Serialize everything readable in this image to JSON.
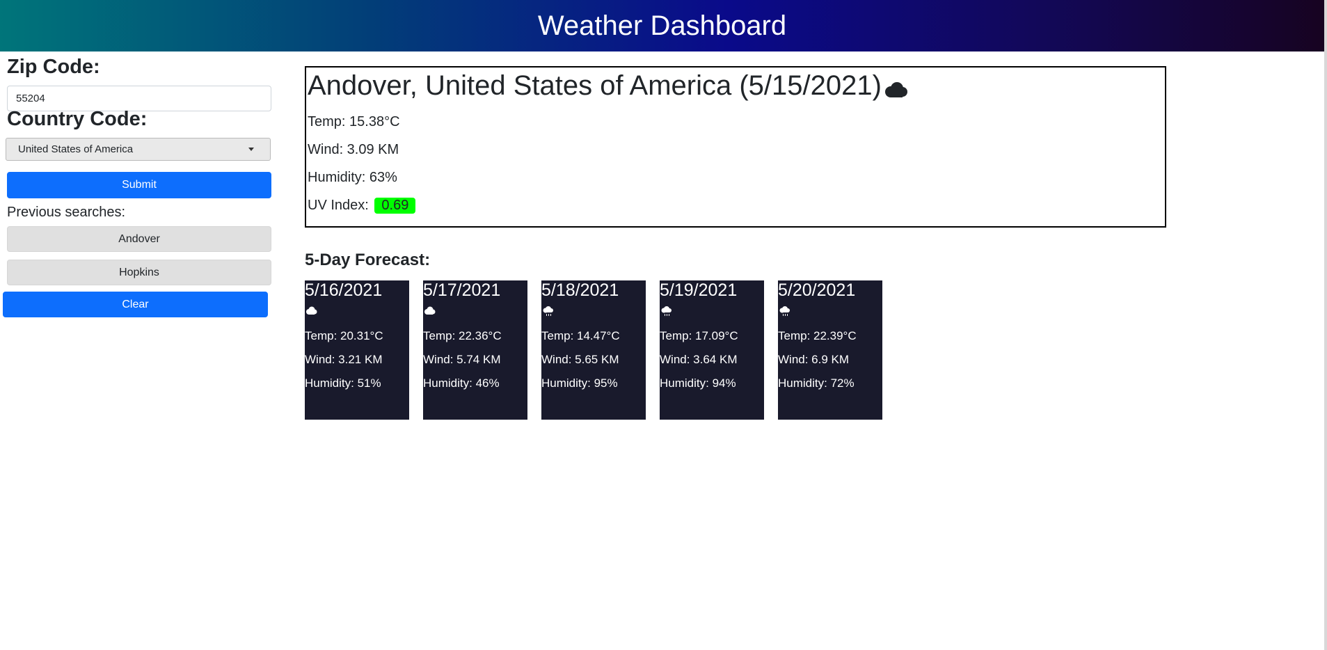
{
  "header": {
    "title": "Weather Dashboard"
  },
  "colors": {
    "header_gradient": [
      "#00757a",
      "#023e78",
      "#0a0a8a",
      "#12085a",
      "#170321"
    ],
    "primary_button": "#0d6efd",
    "forecast_card_bg": "#191a2c",
    "uv_badge": "#00ff00"
  },
  "sidebar": {
    "zip_label": "Zip Code:",
    "zip_value": "55204",
    "country_label": "Country Code:",
    "country_selected": "United States of America",
    "submit_label": "Submit",
    "previous_label": "Previous searches:",
    "history": [
      {
        "label": "Andover"
      },
      {
        "label": "Hopkins"
      }
    ],
    "clear_label": "Clear"
  },
  "current": {
    "title": "Andover, United States of America (5/15/2021)",
    "icon": "cloud-icon",
    "temp": "Temp: 15.38°C",
    "wind": "Wind: 3.09 KM",
    "humidity": "Humidity: 63%",
    "uv_label": "UV Index:",
    "uv_value": "0.69"
  },
  "forecast": {
    "heading": "5-Day Forecast:",
    "days": [
      {
        "date": "5/16/2021",
        "icon": "cloud-icon",
        "temp": "Temp: 20.31°C",
        "wind": "Wind: 3.21 KM",
        "humidity": "Humidity: 51%"
      },
      {
        "date": "5/17/2021",
        "icon": "cloud-icon",
        "temp": "Temp: 22.36°C",
        "wind": "Wind: 5.74 KM",
        "humidity": "Humidity: 46%"
      },
      {
        "date": "5/18/2021",
        "icon": "rain-cloud-icon",
        "temp": "Temp: 14.47°C",
        "wind": "Wind: 5.65 KM",
        "humidity": "Humidity: 95%"
      },
      {
        "date": "5/19/2021",
        "icon": "rain-cloud-icon",
        "temp": "Temp: 17.09°C",
        "wind": "Wind: 3.64 KM",
        "humidity": "Humidity: 94%"
      },
      {
        "date": "5/20/2021",
        "icon": "rain-cloud-icon",
        "temp": "Temp: 22.39°C",
        "wind": "Wind: 6.9 KM",
        "humidity": "Humidity: 72%"
      }
    ]
  }
}
